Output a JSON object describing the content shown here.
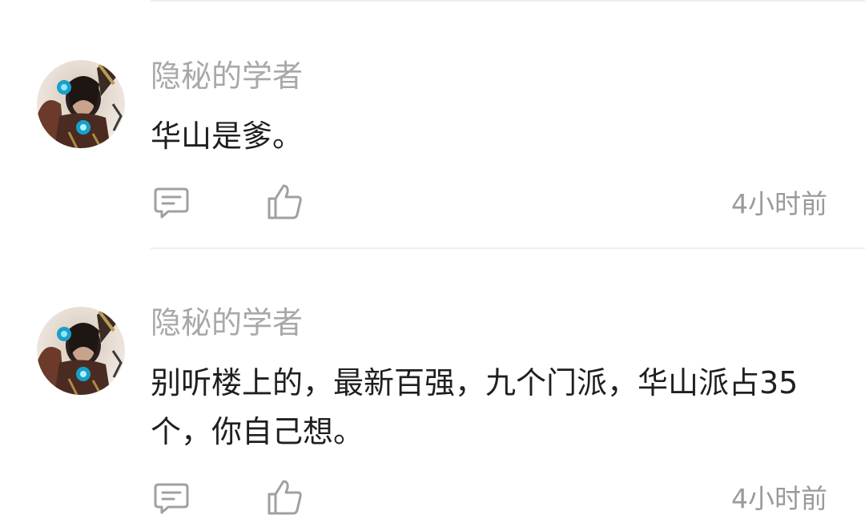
{
  "comments": [
    {
      "user": "隐秘的学者",
      "text": "华山是爹。",
      "time": "4小时前",
      "reply_icon": "comment-bubble-icon",
      "like_icon": "thumbs-up-icon"
    },
    {
      "user": "隐秘的学者",
      "text": "别听楼上的，最新百强，九个门派，华山派占35个，你自己想。",
      "time": "4小时前",
      "reply_icon": "comment-bubble-icon",
      "like_icon": "thumbs-up-icon"
    }
  ],
  "colors": {
    "username": "#a8a8a8",
    "text": "#1f1f1f",
    "icon": "#a0a0a0",
    "divider": "#eeeeee"
  }
}
